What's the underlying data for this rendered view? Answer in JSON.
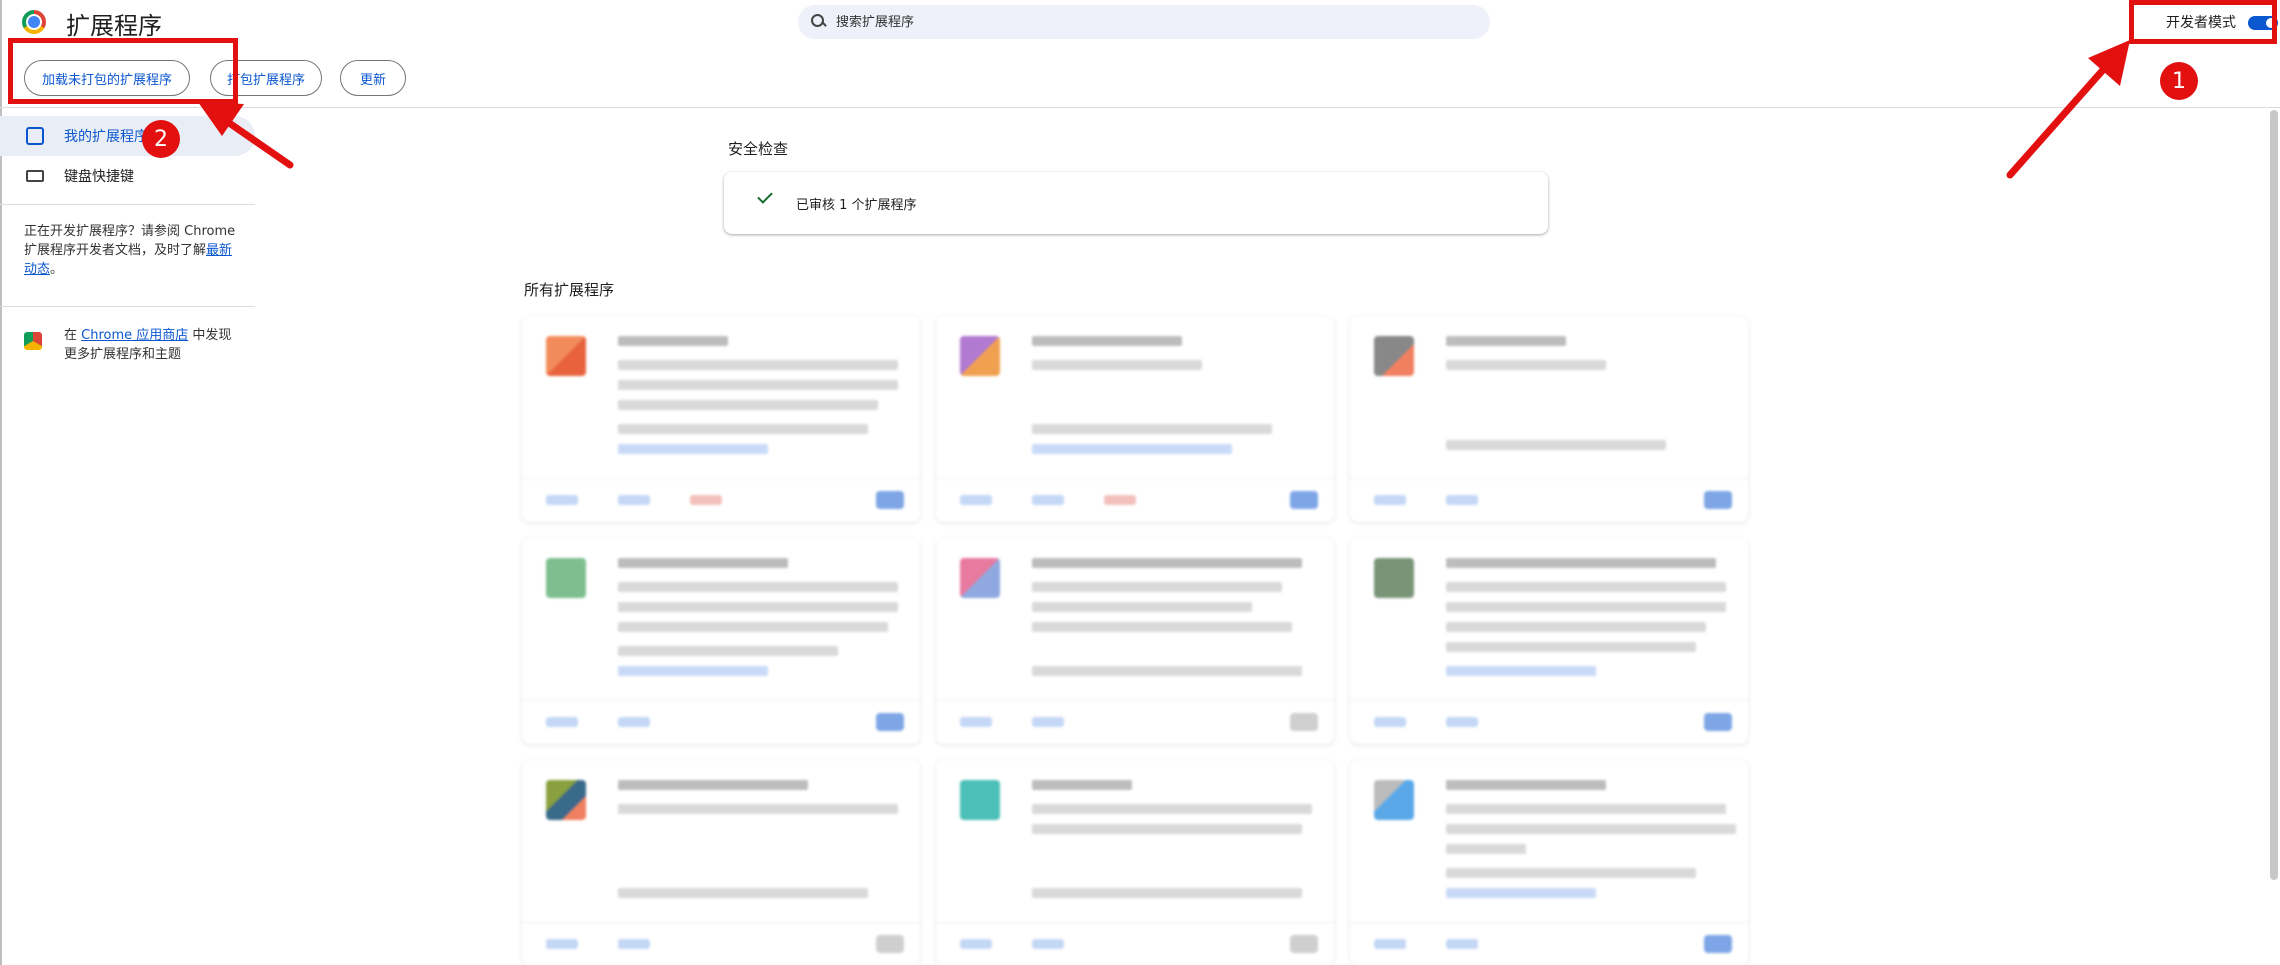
{
  "header": {
    "title": "扩展程序",
    "search_placeholder": "搜索扩展程序",
    "dev_mode_label": "开发者模式",
    "dev_mode_on": true
  },
  "toolbar": {
    "load_unpacked": "加载未打包的扩展程序",
    "pack": "打包扩展程序",
    "update": "更新"
  },
  "sidebar": {
    "items": [
      {
        "label": "我的扩展程序",
        "icon": "puzzle-icon",
        "active": true
      },
      {
        "label": "键盘快捷键",
        "icon": "keyboard-icon",
        "active": false
      }
    ],
    "note_text": "正在开发扩展程序？请参阅 Chrome 扩展程序开发者文档，及时了解",
    "note_link": "最新动态",
    "note_tail": "。",
    "store_prefix": "在",
    "store_link": "Chrome 应用商店",
    "store_suffix": "中发现更多扩展程序和主题"
  },
  "main": {
    "safety_heading": "安全检查",
    "safety_status": "已审核 1 个扩展程序",
    "all_heading": "所有扩展程序"
  },
  "annotations": {
    "badge_1": "1",
    "badge_2": "2",
    "color": "#e31010"
  },
  "colors": {
    "accent": "#0b57d0",
    "active_bg": "#e9eef6",
    "check": "#146c2e"
  }
}
